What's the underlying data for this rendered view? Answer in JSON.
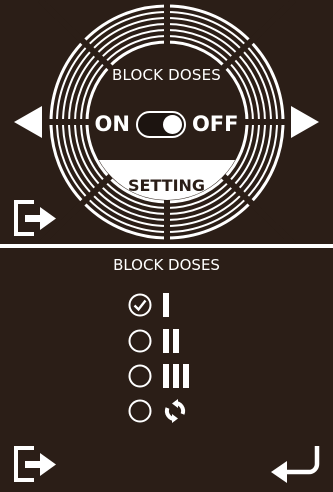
{
  "top_screen": {
    "title": "BLOCK DOSES",
    "toggle": {
      "on_label": "ON",
      "off_label": "OFF",
      "state": "off"
    },
    "setting_button": "SETTING",
    "icons": {
      "prev": "triangle-left-icon",
      "next": "triangle-right-icon",
      "exit": "exit-door-icon"
    }
  },
  "bottom_screen": {
    "title": "BLOCK DOSES",
    "options": [
      {
        "icon": "single-bar-icon",
        "selected": true
      },
      {
        "icon": "double-bar-icon",
        "selected": false
      },
      {
        "icon": "triple-bar-icon",
        "selected": false
      },
      {
        "icon": "repeat-cycle-icon",
        "selected": false
      }
    ],
    "icons": {
      "exit": "exit-door-icon",
      "back": "return-arrow-icon"
    }
  },
  "colors": {
    "background": "#2b1e17",
    "foreground": "#ffffff"
  }
}
